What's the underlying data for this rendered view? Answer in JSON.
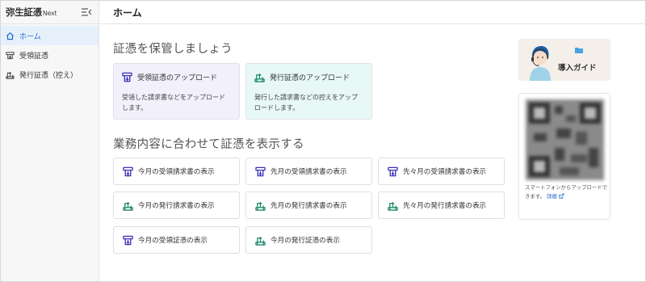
{
  "app": {
    "brand": "弥生証憑",
    "brand_suffix": "Next"
  },
  "sidebar": {
    "items": [
      {
        "label": "ホーム",
        "icon": "home-icon",
        "active": true
      },
      {
        "label": "受領証憑",
        "icon": "receive-icon",
        "active": false
      },
      {
        "label": "発行証憑（控え）",
        "icon": "issue-icon",
        "active": false
      }
    ]
  },
  "header": {
    "title": "ホーム"
  },
  "store_section": {
    "title": "証憑を保管しましょう",
    "cards": [
      {
        "title": "受領証憑のアップロード",
        "desc": "受領した請求書などをアップロードします。",
        "kind": "receive"
      },
      {
        "title": "発行証憑のアップロード",
        "desc": "発行した請求書などの控えをアップロードします。",
        "kind": "issue"
      }
    ]
  },
  "view_section": {
    "title": "業務内容に合わせて証憑を表示する",
    "buttons": [
      {
        "label": "今月の受領請求書の表示",
        "kind": "receive"
      },
      {
        "label": "先月の受領請求書の表示",
        "kind": "receive"
      },
      {
        "label": "先々月の受領請求書の表示",
        "kind": "receive"
      },
      {
        "label": "今月の発行請求書の表示",
        "kind": "issue"
      },
      {
        "label": "先月の発行請求書の表示",
        "kind": "issue"
      },
      {
        "label": "先々月の発行請求書の表示",
        "kind": "issue"
      },
      {
        "label": "今月の受領証憑の表示",
        "kind": "receive"
      },
      {
        "label": "今月の発行証憑の表示",
        "kind": "issue"
      }
    ]
  },
  "guide": {
    "title": "導入ガイド"
  },
  "qr_panel": {
    "note": "スマートフォンからアップロードできます。",
    "link": "詳細"
  },
  "colors": {
    "accent": "#1d68c7",
    "receive_icon": "#3a2fb5",
    "issue_icon": "#1f8a6e",
    "receive_card_bg": "#f1f0fb",
    "issue_card_bg": "#e7f8f5"
  }
}
